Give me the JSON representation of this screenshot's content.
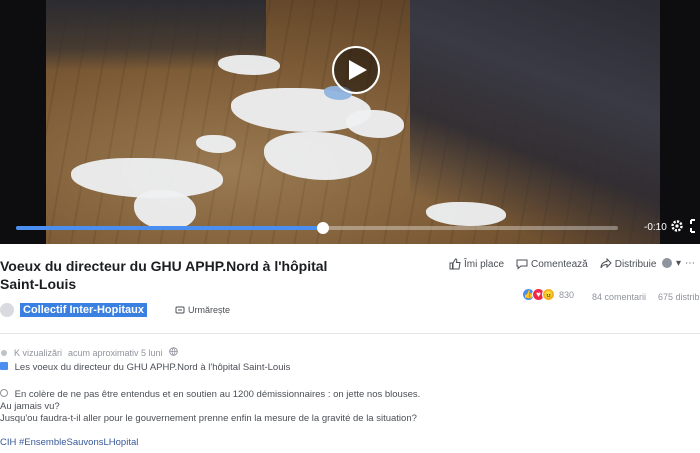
{
  "video": {
    "time": "-0:10",
    "progress_fraction": 0.51,
    "play_icon": "play-icon",
    "settings_icon": "gear-icon",
    "fullscreen_icon": "fullscreen-icon"
  },
  "post": {
    "title_line1": "Voeux du directeur du GHU APHP.Nord à l'hôpital",
    "title_line2": "Saint-Louis",
    "actions": {
      "like": "Îmi place",
      "comment": "Comentează",
      "share": "Distribuie"
    },
    "reactions_count": "830",
    "comments_count": "84 comentarii",
    "shares_count": "675 distribuiri",
    "page_name": "Collectif Inter-Hopitaux",
    "follow_label": "Urmărește",
    "meta_views": "K vizualizări",
    "meta_time": "acum aproximativ 5 luni",
    "desc_title": "Les voeux du directeur du GHU APHP.Nord à l'hôpital Saint-Louis",
    "desc_line1": "En colère de ne pas être entendus et en soutien au 1200 démissionnaires : on jette nos blouses.",
    "desc_line2": "Au jamais vu?",
    "desc_line3": "Jusqu'ou faudra-t-il aller pour le gouvernement prenne enfin la mesure de la gravité de la situation?",
    "hashtags": "CIH #EnsembleSauvonsLHopital"
  },
  "colors": {
    "accent": "#4a8ef0",
    "page_highlight": "#3a80e0",
    "link": "#385898"
  }
}
